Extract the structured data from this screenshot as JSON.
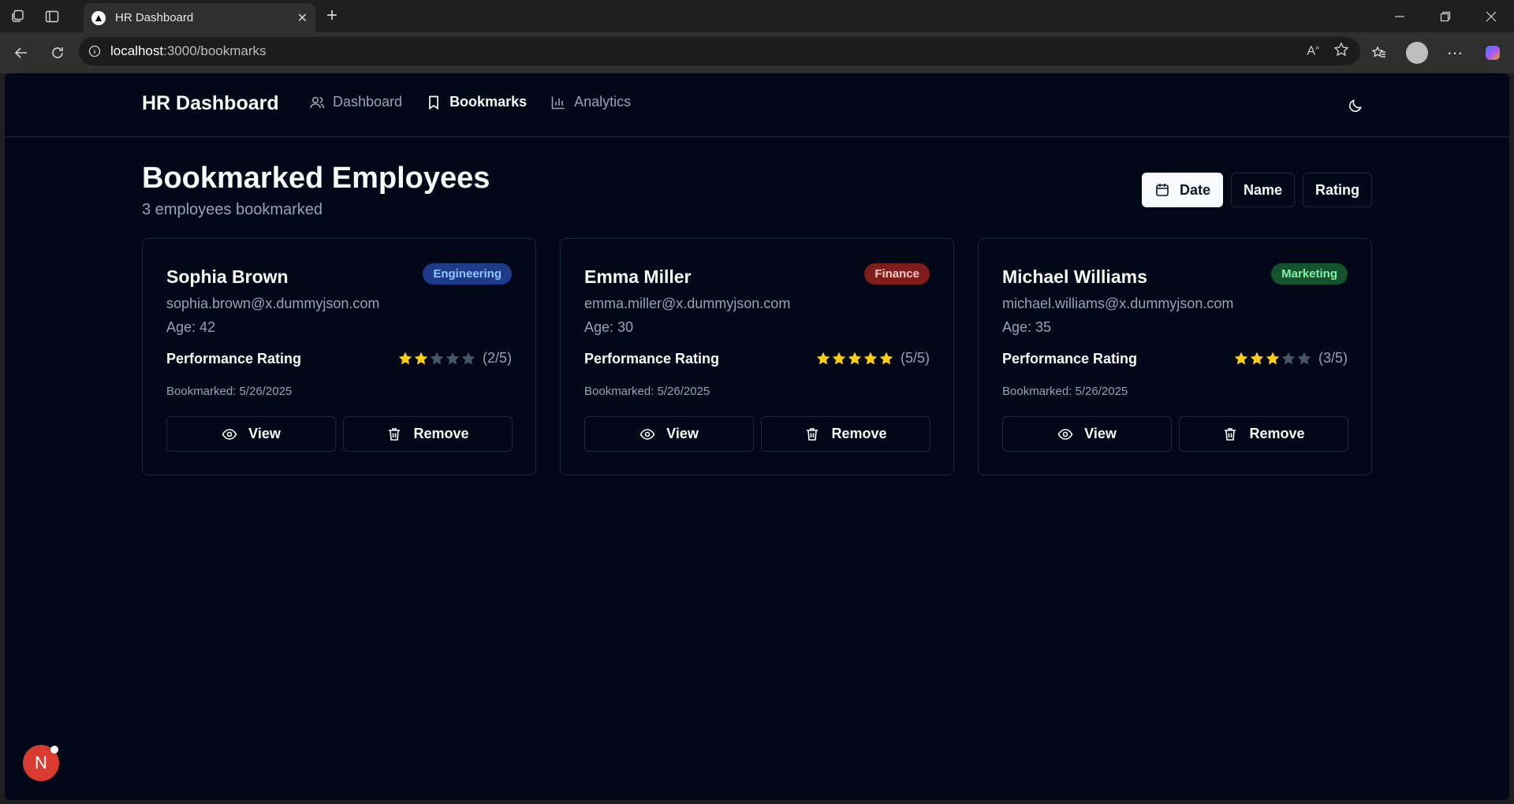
{
  "browser": {
    "tab_title": "HR Dashboard",
    "url_host": "localhost",
    "url_path": ":3000/bookmarks"
  },
  "nav": {
    "brand": "HR Dashboard",
    "links": [
      {
        "label": "Dashboard",
        "icon": "users-icon",
        "active": false
      },
      {
        "label": "Bookmarks",
        "icon": "bookmark-icon",
        "active": true
      },
      {
        "label": "Analytics",
        "icon": "bar-chart-icon",
        "active": false
      }
    ]
  },
  "page": {
    "title": "Bookmarked Employees",
    "subtitle": "3 employees bookmarked",
    "sort": {
      "date": "Date",
      "name": "Name",
      "rating": "Rating",
      "active": "date"
    }
  },
  "colors": {
    "star_filled": "#facc15",
    "star_empty": "#475569",
    "engineering_bg": "#1e40af",
    "engineering_fg": "#93c5fd",
    "finance_bg": "#7f1d1d",
    "finance_fg": "#fecaca",
    "marketing_bg": "#14532d",
    "marketing_fg": "#86efac"
  },
  "employees": [
    {
      "name": "Sophia Brown",
      "department": "Engineering",
      "badge_bg": "#1e3a8a",
      "badge_fg": "#93c5fd",
      "email": "sophia.brown@x.dummyjson.com",
      "age": "Age: 42",
      "rating_label": "Performance Rating",
      "rating": 2,
      "rating_text": "(2/5)",
      "bookmarked": "Bookmarked: 5/26/2025",
      "view_label": "View",
      "remove_label": "Remove"
    },
    {
      "name": "Emma Miller",
      "department": "Finance",
      "badge_bg": "#7f1d1d",
      "badge_fg": "#fecaca",
      "email": "emma.miller@x.dummyjson.com",
      "age": "Age: 30",
      "rating_label": "Performance Rating",
      "rating": 5,
      "rating_text": "(5/5)",
      "bookmarked": "Bookmarked: 5/26/2025",
      "view_label": "View",
      "remove_label": "Remove"
    },
    {
      "name": "Michael Williams",
      "department": "Marketing",
      "badge_bg": "#14532d",
      "badge_fg": "#86efac",
      "email": "michael.williams@x.dummyjson.com",
      "age": "Age: 35",
      "rating_label": "Performance Rating",
      "rating": 3,
      "rating_text": "(3/5)",
      "bookmarked": "Bookmarked: 5/26/2025",
      "view_label": "View",
      "remove_label": "Remove"
    }
  ],
  "dev_badge": "N"
}
